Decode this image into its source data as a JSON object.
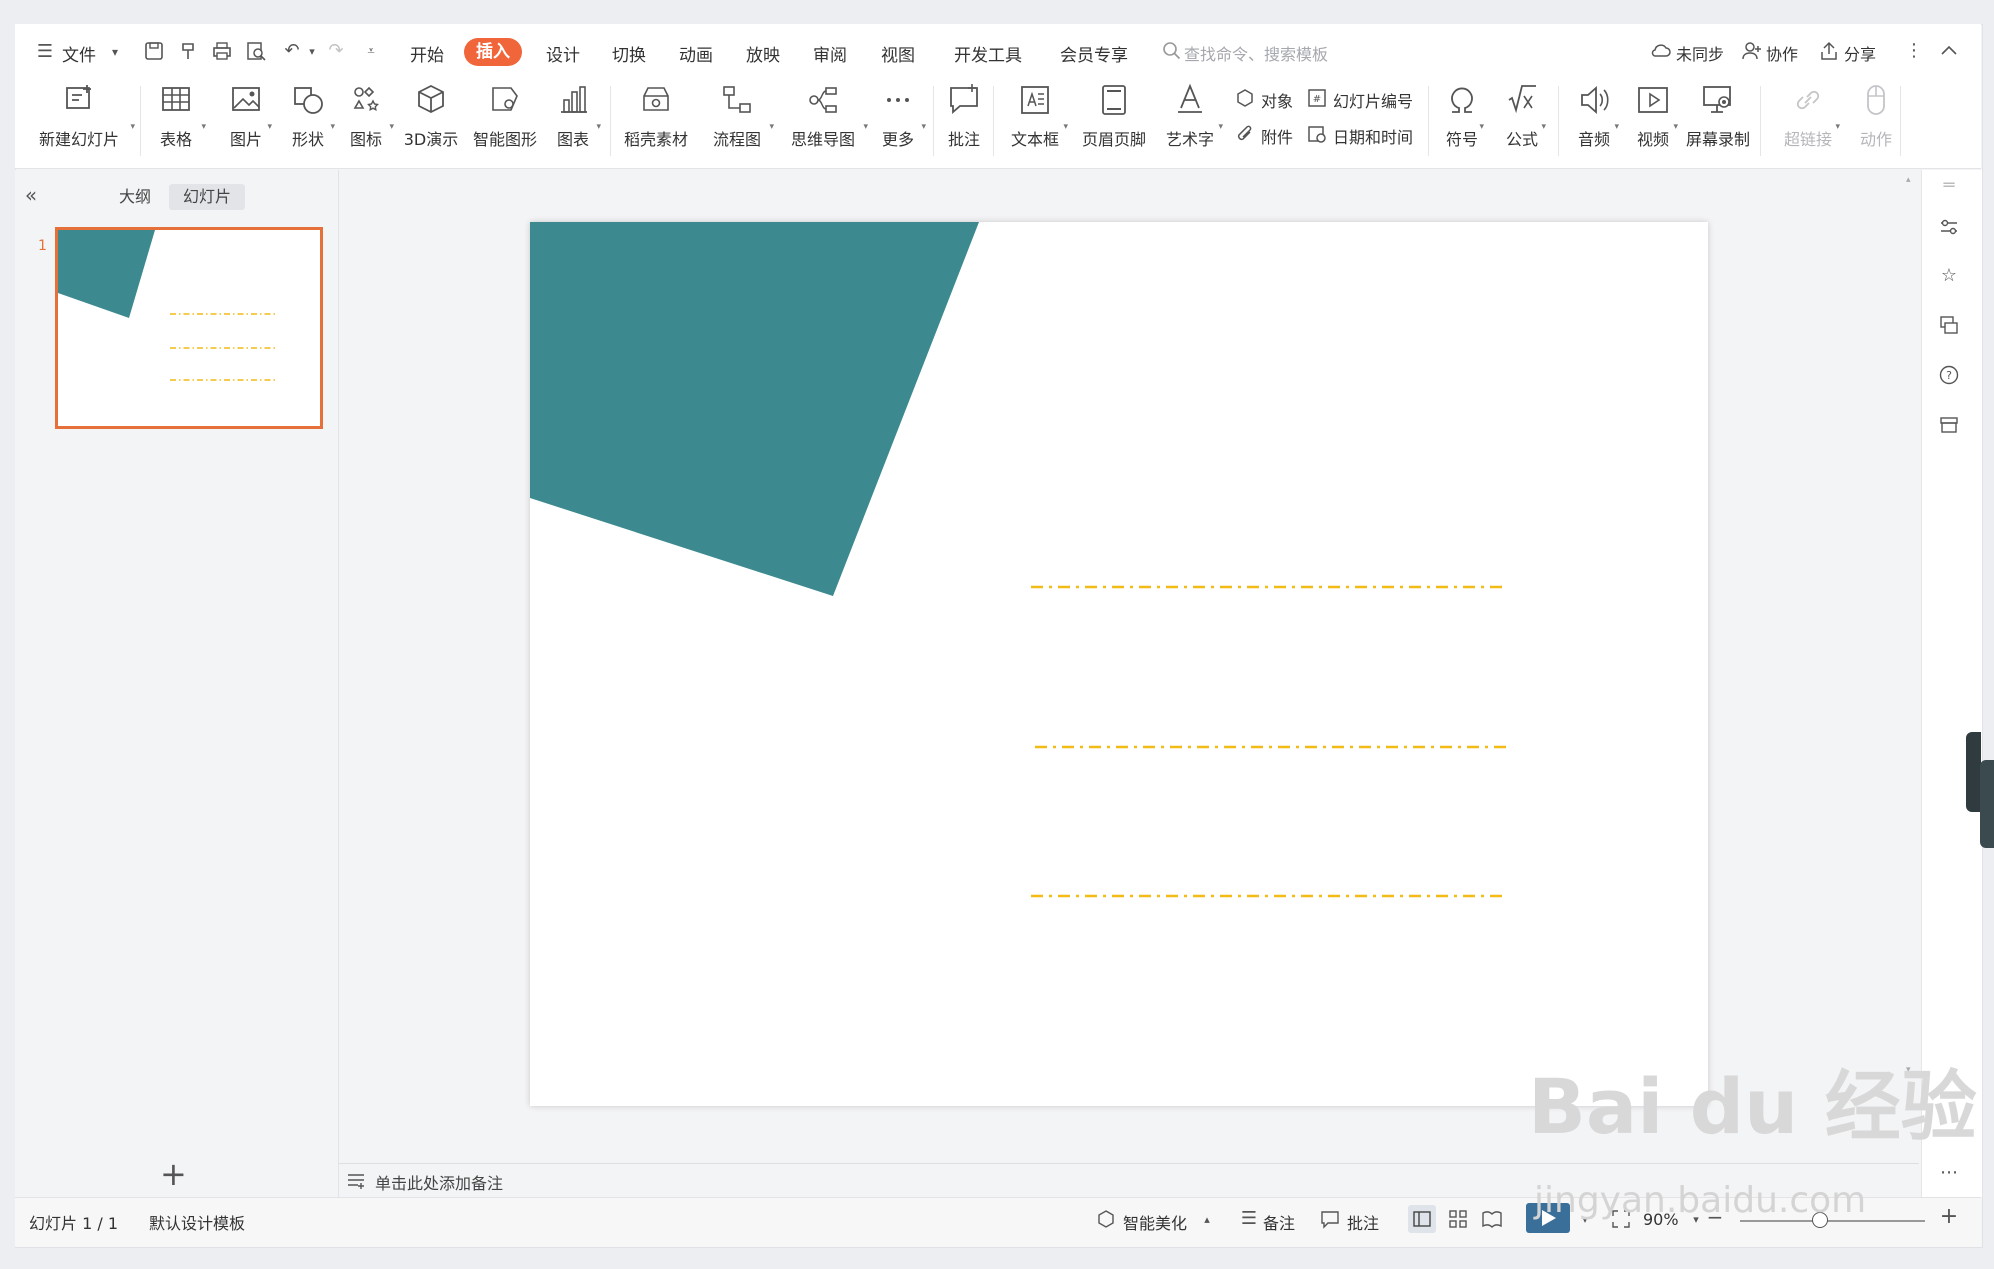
{
  "menu": {
    "file_label": "文件",
    "tabs": [
      "开始",
      "插入",
      "设计",
      "切换",
      "动画",
      "放映",
      "审阅",
      "视图",
      "开发工具",
      "会员专享"
    ],
    "active_tab": "插入",
    "search_placeholder": "查找命令、搜索模板",
    "right": [
      "未同步",
      "协作",
      "分享"
    ]
  },
  "ribbon": {
    "buttons": [
      {
        "label": "新建幻灯片",
        "dropdown": true,
        "icon": "new-slide-icon"
      },
      {
        "label": "表格",
        "dropdown": true,
        "icon": "table-icon"
      },
      {
        "label": "图片",
        "dropdown": true,
        "icon": "picture-icon"
      },
      {
        "label": "形状",
        "dropdown": true,
        "icon": "shape-icon"
      },
      {
        "label": "图标",
        "dropdown": true,
        "icon": "icons-icon"
      },
      {
        "label": "3D演示",
        "dropdown": false,
        "icon": "cube-icon"
      },
      {
        "label": "智能图形",
        "dropdown": false,
        "icon": "smartart-icon"
      },
      {
        "label": "图表",
        "dropdown": true,
        "icon": "chart-icon"
      },
      {
        "label": "稻壳素材",
        "dropdown": false,
        "icon": "material-icon"
      },
      {
        "label": "流程图",
        "dropdown": true,
        "icon": "flowchart-icon"
      },
      {
        "label": "思维导图",
        "dropdown": true,
        "icon": "mindmap-icon"
      },
      {
        "label": "更多",
        "dropdown": true,
        "icon": "more-icon"
      },
      {
        "label": "批注",
        "dropdown": false,
        "icon": "comment-icon"
      },
      {
        "label": "文本框",
        "dropdown": true,
        "icon": "textbox-icon"
      },
      {
        "label": "页眉页脚",
        "dropdown": false,
        "icon": "header-footer-icon"
      },
      {
        "label": "艺术字",
        "dropdown": true,
        "icon": "wordart-icon"
      },
      {
        "label": "符号",
        "dropdown": true,
        "icon": "omega-icon"
      },
      {
        "label": "公式",
        "dropdown": true,
        "icon": "formula-icon"
      },
      {
        "label": "音频",
        "dropdown": true,
        "icon": "audio-icon"
      },
      {
        "label": "视频",
        "dropdown": true,
        "icon": "video-icon"
      },
      {
        "label": "屏幕录制",
        "dropdown": false,
        "icon": "screen-record-icon"
      },
      {
        "label": "超链接",
        "dropdown": true,
        "icon": "link-icon",
        "disabled": true
      },
      {
        "label": "动作",
        "dropdown": false,
        "icon": "action-icon",
        "disabled": true
      }
    ],
    "small": {
      "object": "对象",
      "slide_number": "幻灯片编号",
      "attachment": "附件",
      "datetime": "日期和时间"
    }
  },
  "left_panel": {
    "tabs": [
      "大纲",
      "幻灯片"
    ],
    "active": "幻灯片",
    "slide_index": "1",
    "add_label": "+"
  },
  "notes_placeholder": "单击此处添加备注",
  "status": {
    "slide_count": "幻灯片 1 / 1",
    "template": "默认设计模板",
    "beautify": "智能美化",
    "notes": "备注",
    "comments": "批注",
    "zoom": "90%"
  },
  "slide": {
    "accent_color": "#3c8a8f",
    "line_color": "#f2bb16"
  },
  "watermark": {
    "brand": "Bai du 经验",
    "url": "jingyan.baidu.com"
  }
}
